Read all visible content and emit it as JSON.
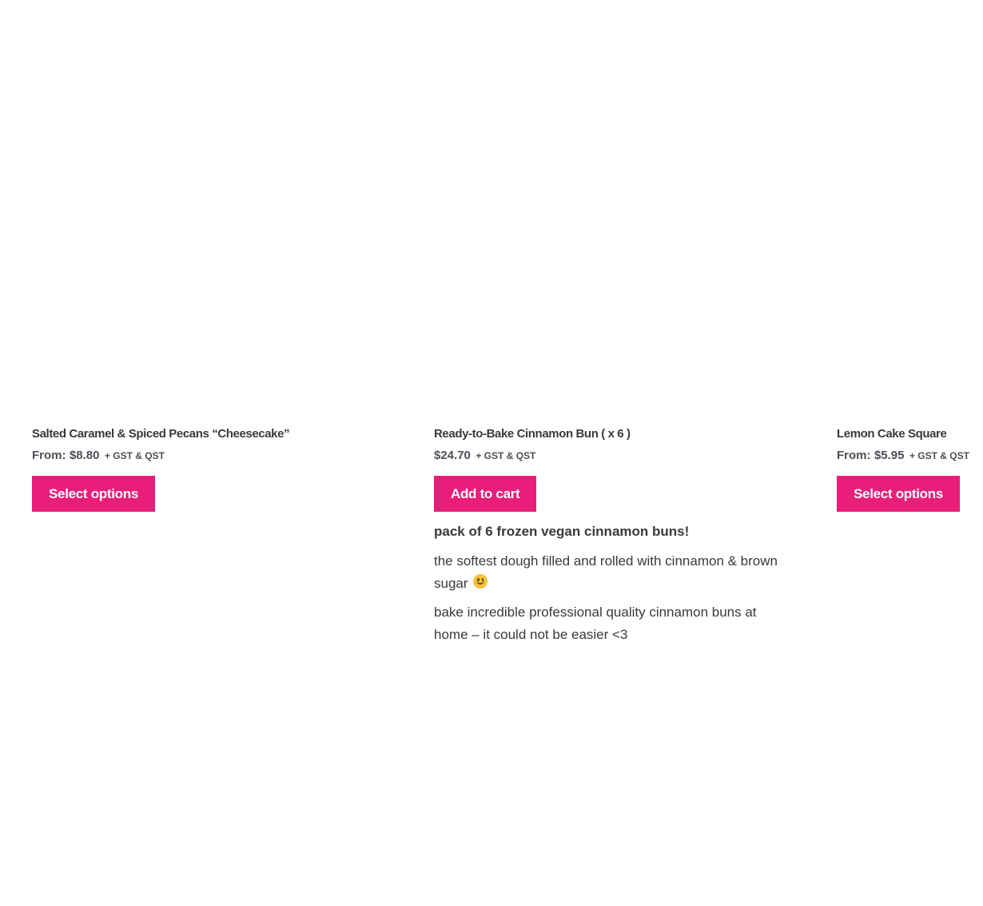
{
  "products": [
    {
      "title": "Salted Caramel & Spiced Pecans “Cheesecake”",
      "price_prefix": "From:",
      "price": "$8.80",
      "tax_note": "+ GST & QST",
      "button_label": "Select options"
    },
    {
      "title": "Ready-to-Bake Cinnamon Bun ( x 6 )",
      "price_prefix": "",
      "price": "$24.70",
      "tax_note": "+ GST & QST",
      "button_label": "Add to cart",
      "description": {
        "lead": "pack of 6 frozen vegan cinnamon buns!",
        "line2": "the softest dough filled and rolled with cinnamon & brown sugar",
        "line2_icon": "smiley-emoji-icon",
        "line3": "bake incredible professional quality cinnamon buns at home – it could not be easier <3"
      }
    },
    {
      "title": "Lemon Cake Square",
      "price_prefix": "From:",
      "price": "$5.95",
      "tax_note": "+ GST & QST",
      "button_label": "Select options"
    }
  ],
  "colors": {
    "button_bg": "#e91e7a",
    "button_text": "#ffffff",
    "text": "#3a3a3a"
  }
}
